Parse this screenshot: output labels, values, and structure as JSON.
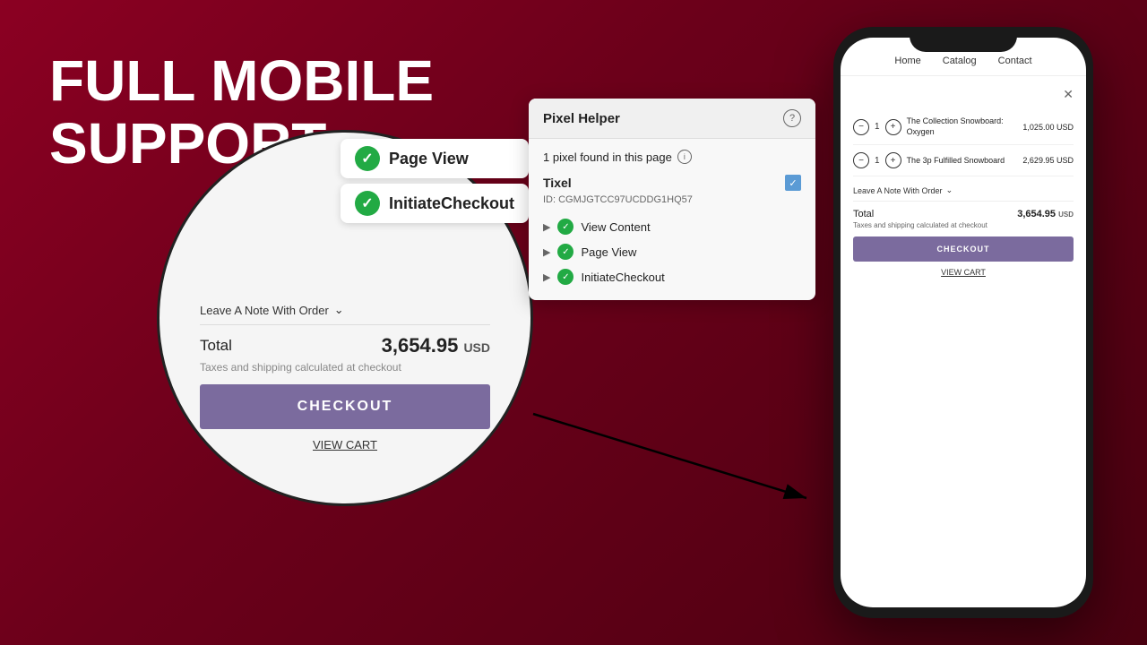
{
  "heading": {
    "line1": "FULL MOBILE",
    "line2": "SUPPORT"
  },
  "phone": {
    "nav": {
      "home": "Home",
      "catalog": "Catalog",
      "contact": "Contact"
    },
    "cart_items": [
      {
        "name": "The Collection Snowboard: Oxygen",
        "qty": 1,
        "price": "1,025.00",
        "currency": "USD"
      },
      {
        "name": "The 3p Fulfilled Snowboard",
        "qty": 1,
        "price": "2,629.95",
        "currency": "USD"
      }
    ],
    "leave_note": "Leave A Note With Order",
    "total_label": "Total",
    "total_amount": "3,654.95",
    "total_currency": "USD",
    "tax_note": "Taxes and shipping calculated at checkout",
    "checkout_btn": "CHECKOUT",
    "view_cart": "VIEW CART"
  },
  "zoom_circle": {
    "events": [
      {
        "name": "Page View"
      },
      {
        "name": "InitiateCheckout"
      }
    ],
    "leave_note": "Leave A Note With Order",
    "total_label": "Total",
    "total_amount": "3,654.95",
    "total_currency": "USD",
    "tax_note": "Taxes and shipping calculated at checkout",
    "checkout_btn": "CHECKOUT",
    "view_cart": "VIEW CART"
  },
  "pixel_helper": {
    "title": "Pixel Helper",
    "help_icon": "?",
    "found_text": "1 pixel found in this page",
    "info_icon": "i",
    "tixel_name": "Tixel",
    "tixel_id": "ID: CGMJGTCC97UCDDG1HQ57",
    "events": [
      {
        "name": "View Content"
      },
      {
        "name": "Page View"
      },
      {
        "name": "InitiateCheckout"
      }
    ]
  }
}
